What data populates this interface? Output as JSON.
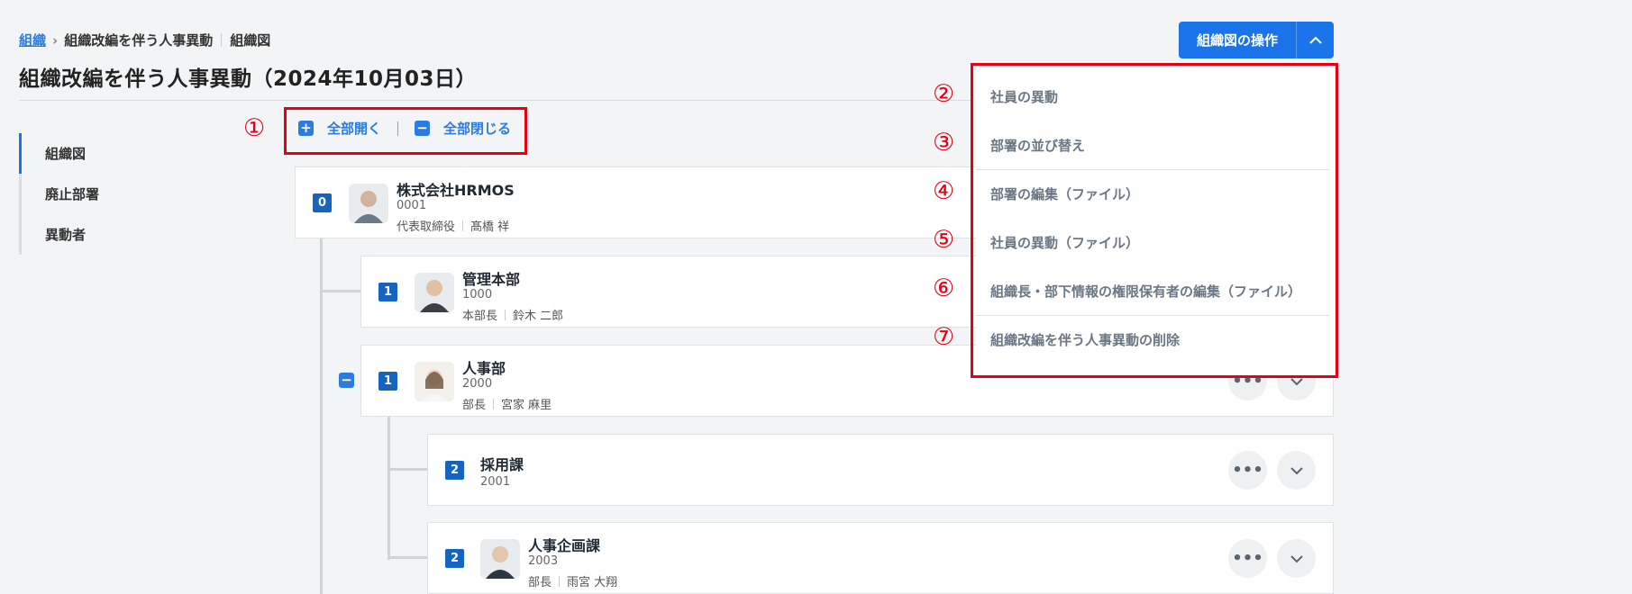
{
  "breadcrumb": {
    "link": "組織",
    "item2": "組織改編を伴う人事異動",
    "item3": "組織図"
  },
  "page_title": "組織改編を伴う人事異動（2024年10月03日）",
  "side_nav": [
    {
      "label": "組織図",
      "active": true
    },
    {
      "label": "廃止部署",
      "active": false
    },
    {
      "label": "異動者",
      "active": false
    }
  ],
  "toggle": {
    "expand_all": "全部開く",
    "collapse_all": "全部閉じる",
    "expand_icon": "plus-square-icon",
    "collapse_icon": "minus-square-icon"
  },
  "annotations": [
    "①",
    "②",
    "③",
    "④",
    "⑤",
    "⑥",
    "⑦"
  ],
  "ops_button": {
    "label": "組織図の操作",
    "icon": "chevron-up-icon"
  },
  "menu": [
    "社員の異動",
    "部署の並び替え",
    "部署の編集（ファイル）",
    "社員の異動（ファイル）",
    "組織長・部下情報の権限保有者の編集（ファイル）",
    "組織改編を伴う人事異動の削除"
  ],
  "cards": [
    {
      "level": "0",
      "name": "株式会社HRMOS",
      "code": "0001",
      "title": "代表取締役",
      "person": "髙橋 祥"
    },
    {
      "level": "1",
      "name": "管理本部",
      "code": "1000",
      "title": "本部長",
      "person": "鈴木 二郎"
    },
    {
      "level": "1",
      "name": "人事部",
      "code": "2000",
      "title": "部長",
      "person": "宮家 麻里"
    },
    {
      "level": "2",
      "name": "採用課",
      "code": "2001",
      "title": "",
      "person": ""
    },
    {
      "level": "2",
      "name": "人事企画課",
      "code": "2003",
      "title": "部長",
      "person": "雨宮 大翔"
    }
  ],
  "icons": {
    "more": "more-horizontal-icon",
    "expand": "chevron-down-icon"
  },
  "colors": {
    "accent": "#1a73e8",
    "annotation": "#e60012",
    "level_badge": "#1565c0"
  }
}
